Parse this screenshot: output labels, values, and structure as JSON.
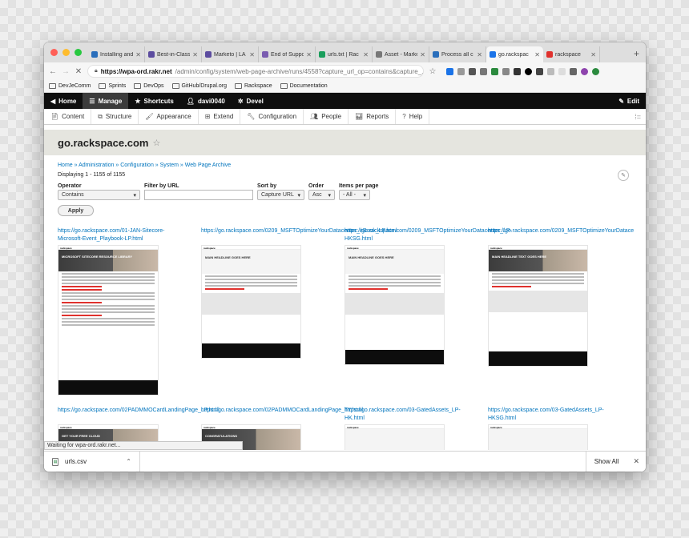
{
  "colors": {
    "accent": "#0074bd",
    "toolbar_bg": "#0f0f0f",
    "rackspace_red": "#e0312d"
  },
  "traffic_lights": [
    "#ff5f57",
    "#febc2e",
    "#28c840"
  ],
  "tabs": [
    {
      "label": "Installing and",
      "icon": "globe-icon",
      "color": "#2a6ebb"
    },
    {
      "label": "Best-in-Class",
      "icon": "marketo-icon",
      "color": "#5c4c9f"
    },
    {
      "label": "Marketo | LA",
      "icon": "marketo-icon",
      "color": "#5c4c9f"
    },
    {
      "label": "End of Suppo",
      "icon": "chart-icon",
      "color": "#7a5cb0"
    },
    {
      "label": "urls.txt | Rac",
      "icon": "sheets-icon",
      "color": "#1a9e5c"
    },
    {
      "label": "Asset - Marke",
      "icon": "doc-icon",
      "color": "#777777"
    },
    {
      "label": "Process all c",
      "icon": "globe-icon",
      "color": "#2a6ebb"
    },
    {
      "label": "go.rackspac",
      "icon": "loading-icon",
      "color": "#1a73e8"
    },
    {
      "label": "rackspace",
      "icon": "rackspace-icon",
      "color": "#e0312d"
    }
  ],
  "address": {
    "url_bold": "https://wpa-ord.rakr.net",
    "url_rest": "/admin/config/system/web-page-archive/runs/4558?capture_url_op=contains&capture_..."
  },
  "bookmarks": [
    "DevJeComm",
    "Sprints",
    "DevOps",
    "GitHub/Drupal.org",
    "Rackspace",
    "Documentation"
  ],
  "drupal_toolbar": {
    "home": "Home",
    "manage": "Manage",
    "shortcuts": "Shortcuts",
    "user": "davi0040",
    "devel": "Devel",
    "edit": "Edit"
  },
  "tray": [
    "Content",
    "Structure",
    "Appearance",
    "Extend",
    "Configuration",
    "People",
    "Reports",
    "Help"
  ],
  "page": {
    "title": "go.rackspace.com",
    "breadcrumb": "Home » Administration » Configuration » System » Web Page Archive",
    "displaying": "Displaying 1 - 1155 of 1155"
  },
  "filters": {
    "operator_label": "Operator",
    "operator_value": "Contains",
    "url_label": "Filter by URL",
    "url_value": "",
    "sort_label": "Sort by",
    "sort_value": "Capture URL",
    "order_label": "Order",
    "order_value": "Asc",
    "per_page_label": "Items per page",
    "per_page_value": "- All -",
    "apply_label": "Apply"
  },
  "results": [
    {
      "url": "https://go.rackspace.com/01-JAN-Sitecore-\nMicrosoft-Event_Playbook-LP.html",
      "thumb_title": "MICROSOFT SITECORE RESOURCE LIBRARY"
    },
    {
      "url": "https://go.rackspace.com/0209_MSFTOptimizeYourDatacenter_eBook_LP.html",
      "thumb_title": "MAIN HEADLINE GOES HERE"
    },
    {
      "url": "https://go.rackspace.com/0209_MSFTOptimizeYourDatacenter_LP-\nHKSG.html",
      "thumb_title": "MAIN HEADLINE GOES HERE"
    },
    {
      "url": "https://go.rackspace.com/0209_MSFTOptimizeYourDatace",
      "thumb_title": "MAIN HEADLINE TEXT GOES HERE"
    },
    {
      "url": "https://go.rackspace.com/02PADMMOCardLandingPage_LP.html",
      "thumb_title": "GET YOUR FREE CLOUD"
    },
    {
      "url": "https://go.rackspace.com/02PADMMOCardLandingPage_TY.html",
      "thumb_title": "CONGRATULATIONS"
    },
    {
      "url": "https://go.rackspace.com/03-GatedAssets_LP-\nHK.html",
      "thumb_title": ""
    },
    {
      "url": "https://go.rackspace.com/03-GatedAssets_LP-\nHKSG.html",
      "thumb_title": ""
    }
  ],
  "thumb_logo": "rackspace",
  "status_tip": "Waiting for wpa-ord.rakr.net...",
  "downloads": {
    "file": "urls.csv",
    "show_all": "Show All"
  }
}
